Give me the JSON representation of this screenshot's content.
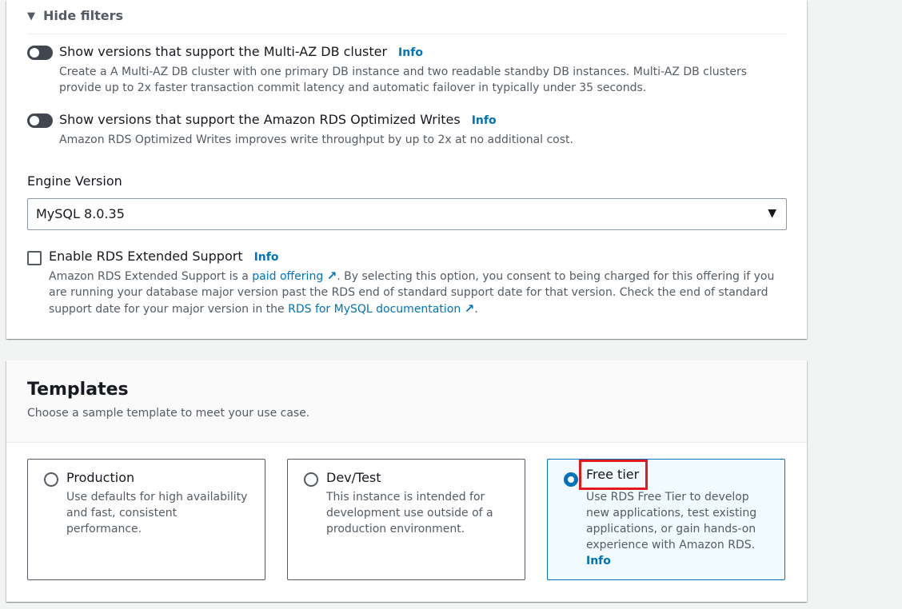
{
  "filters": {
    "header": "Hide filters",
    "multi_az": {
      "title": "Show versions that support the Multi-AZ DB cluster",
      "info": "Info",
      "description": "Create a A Multi-AZ DB cluster with one primary DB instance and two readable standby DB instances. Multi-AZ DB clusters provide up to 2x faster transaction commit latency and automatic failover in typically under 35 seconds."
    },
    "optimized_writes": {
      "title": "Show versions that support the Amazon RDS Optimized Writes",
      "info": "Info",
      "description": "Amazon RDS Optimized Writes improves write throughput by up to 2x at no additional cost."
    }
  },
  "engine": {
    "label": "Engine Version",
    "selected": "MySQL 8.0.35"
  },
  "extended_support": {
    "title": "Enable RDS Extended Support",
    "info": "Info",
    "desc_part1": "Amazon RDS Extended Support is a ",
    "link1": "paid offering",
    "desc_part2": ". By selecting this option, you consent to being charged for this offering if you are running your database major version past the RDS end of standard support date for that version. Check the end of standard support date for your major version in the ",
    "link2": "RDS for MySQL documentation",
    "desc_part3": "."
  },
  "templates": {
    "title": "Templates",
    "subtitle": "Choose a sample template to meet your use case.",
    "options": [
      {
        "title": "Production",
        "description": "Use defaults for high availability and fast, consistent performance."
      },
      {
        "title": "Dev/Test",
        "description": "This instance is intended for development use outside of a production environment."
      },
      {
        "title": "Free tier",
        "description": "Use RDS Free Tier to develop new applications, test existing applications, or gain hands-on experience with Amazon RDS.",
        "info": "Info"
      }
    ]
  },
  "colors": {
    "link": "#0073bb",
    "highlight": "#e3191d"
  }
}
